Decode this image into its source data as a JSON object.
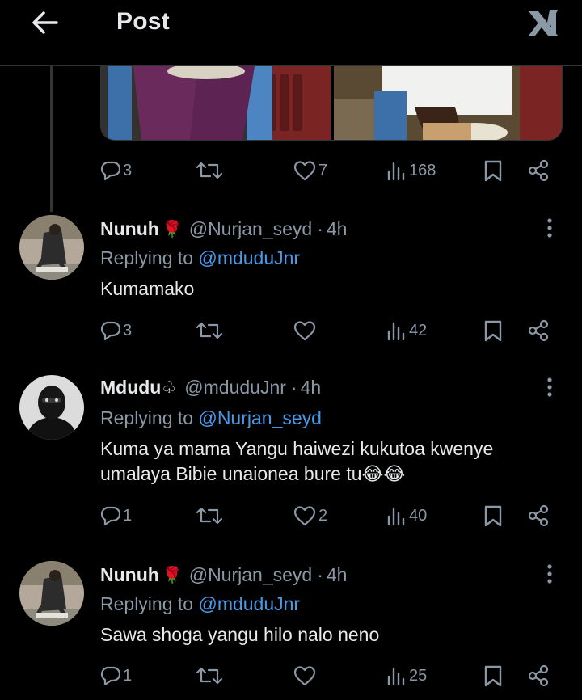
{
  "header": {
    "title": "Post"
  },
  "post": {
    "replies": "3",
    "reposts": "",
    "likes": "7",
    "views": "168"
  },
  "replies": [
    {
      "display_name": "Nunuh",
      "name_emoji": "🌹",
      "handle": "@Nurjan_seyd",
      "time": "4h",
      "replying_prefix": "Replying to",
      "replying_to": "@mduduJnr",
      "text": "Kumamako",
      "stats": {
        "replies": "3",
        "reposts": "",
        "likes": "",
        "views": "42"
      }
    },
    {
      "display_name": "Mdudu",
      "name_emoji": "♧",
      "handle": "@mduduJnr",
      "time": "4h",
      "replying_prefix": "Replying to",
      "replying_to": "@Nurjan_seyd",
      "text": "Kuma ya mama Yangu haiwezi kukutoa kwenye umalaya Bibie unaionea bure tu",
      "text_emoji": "😂😂",
      "stats": {
        "replies": "1",
        "reposts": "",
        "likes": "2",
        "views": "40"
      }
    },
    {
      "display_name": "Nunuh",
      "name_emoji": "🌹",
      "handle": "@Nurjan_seyd",
      "time": "4h",
      "replying_prefix": "Replying to",
      "replying_to": "@mduduJnr",
      "text": "Sawa shoga yangu hilo nalo neno",
      "stats": {
        "replies": "1",
        "reposts": "",
        "likes": "",
        "views": "25"
      }
    }
  ],
  "colors": {
    "background": "#000000",
    "text": "#e7e9ea",
    "secondary": "#8b98a5",
    "link": "#4a99e9",
    "divider": "#2f3336"
  },
  "icons": [
    "back-arrow-icon",
    "x-logo-icon",
    "reply-icon",
    "repost-icon",
    "like-icon",
    "views-icon",
    "bookmark-icon",
    "share-icon",
    "more-icon"
  ]
}
